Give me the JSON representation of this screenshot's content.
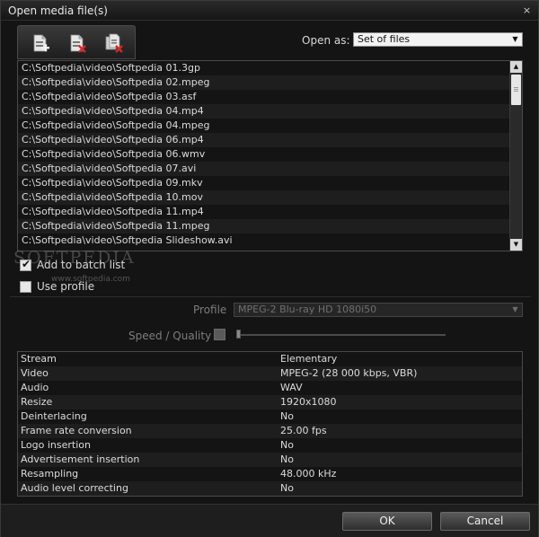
{
  "window": {
    "title": "Open media file(s)",
    "close_glyph": "×"
  },
  "toolbar": {
    "buttons": [
      {
        "icon": "add-file-icon"
      },
      {
        "icon": "remove-file-icon"
      },
      {
        "icon": "remove-all-files-icon"
      }
    ]
  },
  "open_as": {
    "label": "Open as:",
    "value": "Set of files"
  },
  "files": [
    "C:\\Softpedia\\video\\Softpedia 01.3gp",
    "C:\\Softpedia\\video\\Softpedia 02.mpeg",
    "C:\\Softpedia\\video\\Softpedia 03.asf",
    "C:\\Softpedia\\video\\Softpedia 04.mp4",
    "C:\\Softpedia\\video\\Softpedia 04.mpeg",
    "C:\\Softpedia\\video\\Softpedia 06.mp4",
    "C:\\Softpedia\\video\\Softpedia 06.wmv",
    "C:\\Softpedia\\video\\Softpedia 07.avi",
    "C:\\Softpedia\\video\\Softpedia 09.mkv",
    "C:\\Softpedia\\video\\Softpedia 10.mov",
    "C:\\Softpedia\\video\\Softpedia 11.mp4",
    "C:\\Softpedia\\video\\Softpedia 11.mpeg",
    "C:\\Softpedia\\video\\Softpedia Slideshow.avi"
  ],
  "options": {
    "add_to_batch": {
      "label": "Add to batch list",
      "checked": true
    },
    "use_profile": {
      "label": "Use profile",
      "checked": false
    }
  },
  "watermark": {
    "text": "SOFTPEDIA",
    "sub": "www.softpedia.com"
  },
  "profile": {
    "label": "Profile",
    "value": "MPEG-2 Blu-ray HD 1080i50"
  },
  "speed_quality": {
    "label": "Speed / Quality",
    "value": 0
  },
  "properties": [
    {
      "key": "Stream",
      "value": "Elementary"
    },
    {
      "key": "Video",
      "value": "MPEG-2 (28 000 kbps, VBR)"
    },
    {
      "key": "Audio",
      "value": "WAV"
    },
    {
      "key": "Resize",
      "value": "1920x1080"
    },
    {
      "key": "Deinterlacing",
      "value": "No"
    },
    {
      "key": "Frame rate conversion",
      "value": "25.00 fps"
    },
    {
      "key": "Logo insertion",
      "value": "No"
    },
    {
      "key": "Advertisement insertion",
      "value": "No"
    },
    {
      "key": "Resampling",
      "value": "48.000 kHz"
    },
    {
      "key": "Audio level correcting",
      "value": "No"
    }
  ],
  "buttons": {
    "ok": "OK",
    "cancel": "Cancel"
  },
  "colors": {
    "window_bg": "#141414",
    "accent_red": "#d42a2a"
  }
}
